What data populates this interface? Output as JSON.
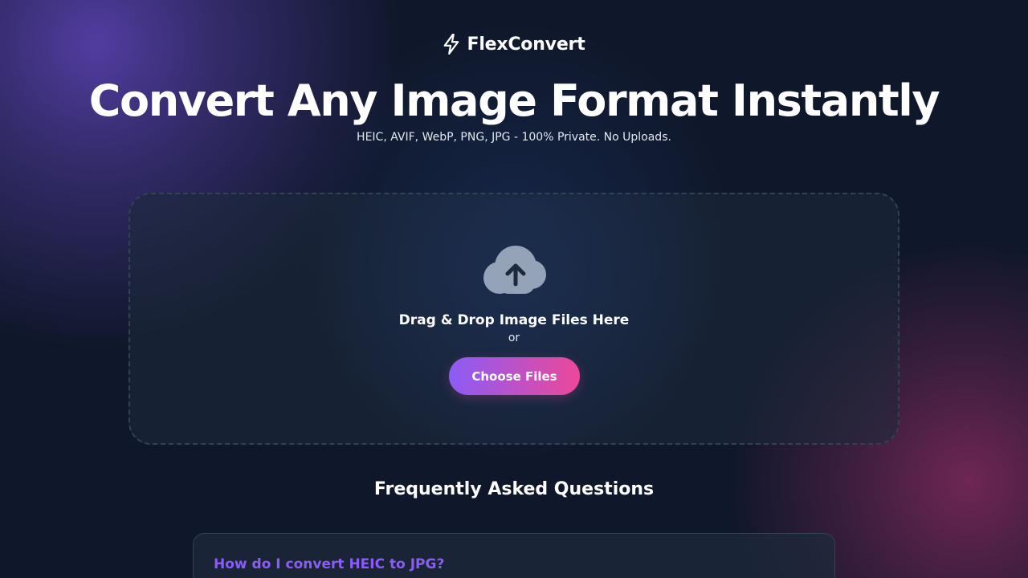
{
  "app": {
    "name": "FlexConvert",
    "logo_icon": "lightning-bolt-icon"
  },
  "hero": {
    "title": "Convert Any Image Format Instantly",
    "subtitle": "HEIC, AVIF, WebP, PNG, JPG - 100% Private. No Uploads."
  },
  "dropzone": {
    "icon": "cloud-upload-icon",
    "title": "Drag & Drop Image Files Here",
    "or_text": "or",
    "button_label": "Choose Files"
  },
  "faq": {
    "heading": "Frequently Asked Questions",
    "items": [
      {
        "question": "How do I convert HEIC to JPG?"
      }
    ]
  },
  "colors": {
    "background": "#0f172a",
    "accent_purple": "#8b5cf6",
    "accent_pink": "#ec4899",
    "cloud_icon": "#94a3b8"
  }
}
